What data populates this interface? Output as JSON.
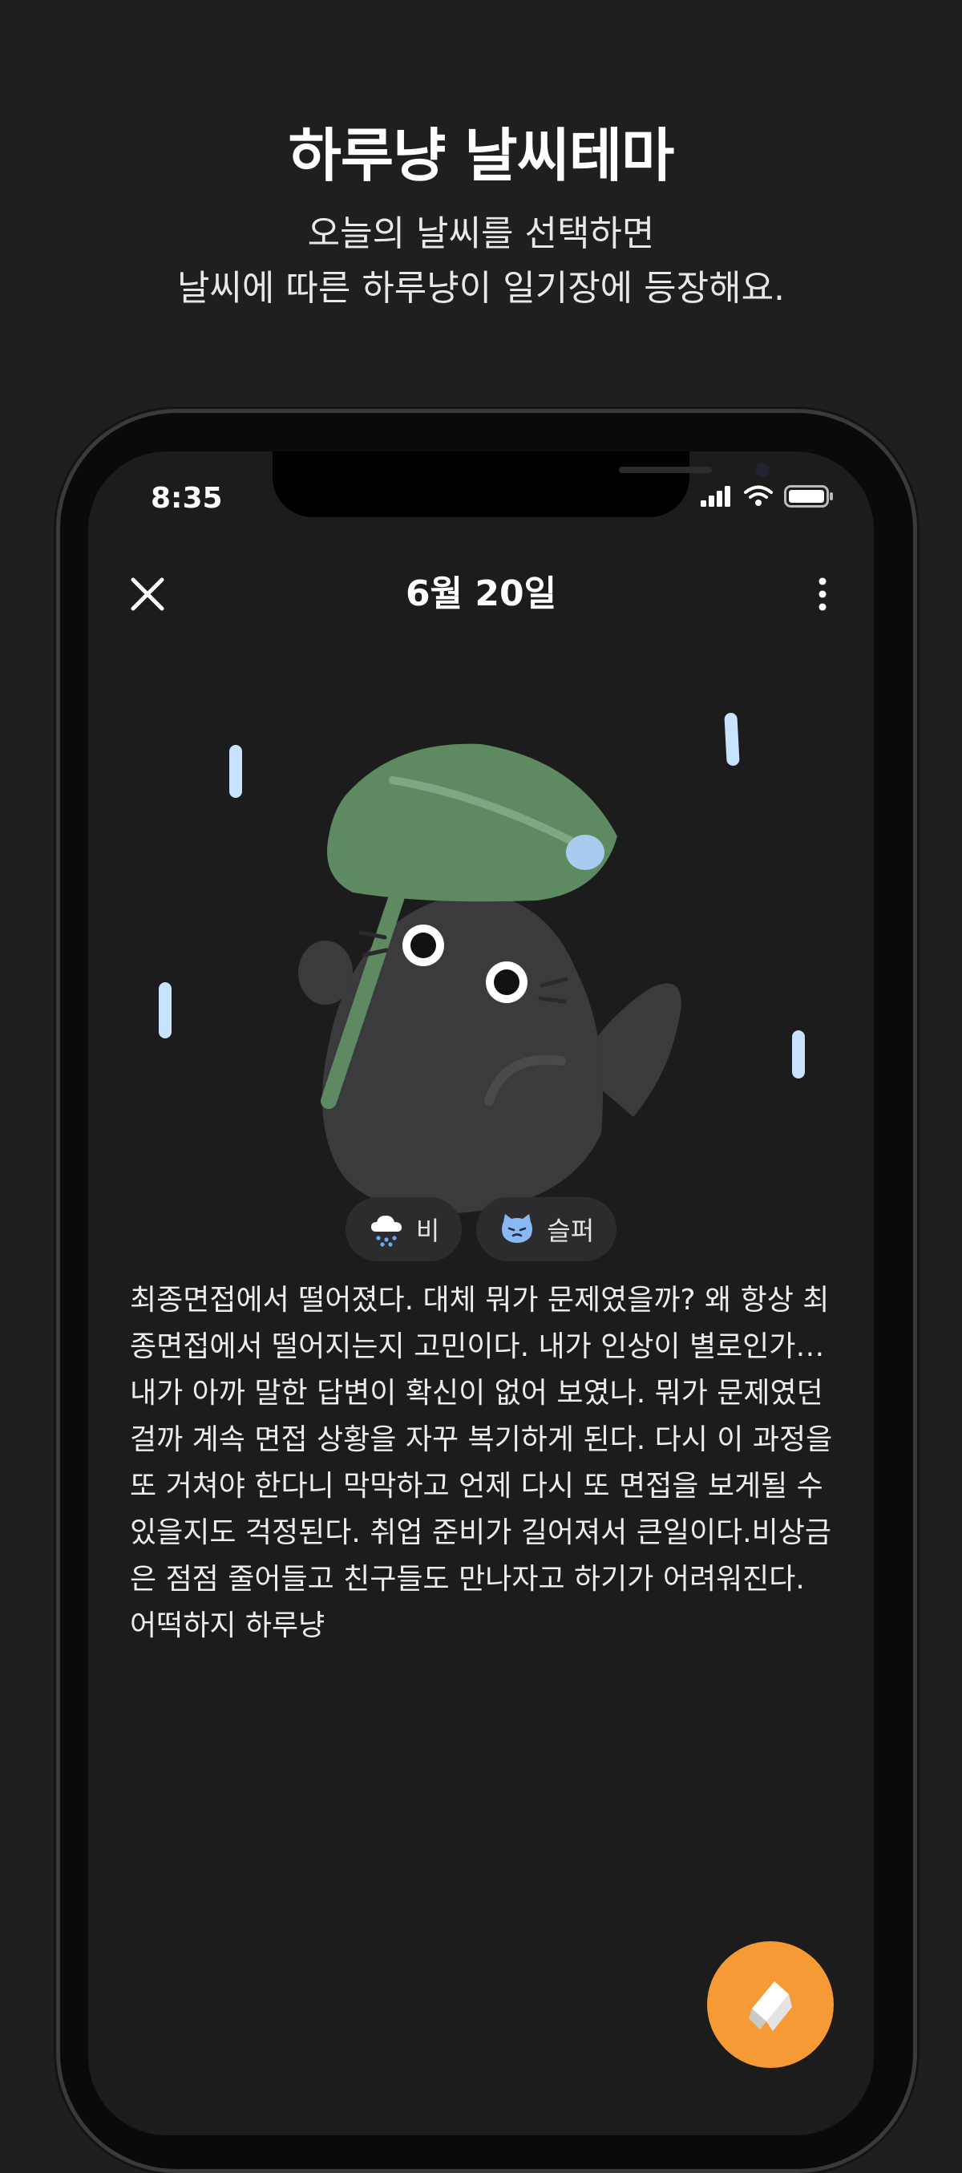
{
  "promo": {
    "title": "하루냥 날씨테마",
    "subtitle_line1": "오늘의 날씨를 선택하면",
    "subtitle_line2": "날씨에 따른 하루냥이 일기장에 등장해요."
  },
  "status_bar": {
    "time": "8:35"
  },
  "nav": {
    "close_icon": "close-icon",
    "title": "6월 20일",
    "more_icon": "more-vertical-icon"
  },
  "chips": {
    "weather": {
      "icon": "rain-cloud-icon",
      "label": "비"
    },
    "mood": {
      "icon": "sad-cat-icon",
      "label": "슬퍼"
    }
  },
  "diary": {
    "text": "최종면접에서 떨어졌다. 대체 뭐가 문제였을까? 왜 항상 최종면접에서 떨어지는지 고민이다. 내가 인상이 별로인가… 내가 아까 말한 답변이 확신이 없어 보였나. 뭐가 문제였던걸까 계속 면접 상황을 자꾸 복기하게 된다. 다시 이 과정을 또 거쳐야 한다니 막막하고 언제 다시 또 면접을 보게될 수 있을지도 걱정된다. 취업 준비가 길어져서 큰일이다.비상금은 점점 줄어들고 친구들도 만나자고 하기가 어려워진다. 어떡하지 하루냥"
  },
  "fab": {
    "icon": "edit-pencil-icon"
  },
  "colors": {
    "background": "#1f1f1f",
    "screen": "#1c1c1d",
    "chip": "#2c2c2e",
    "accent_orange": "#f59a34",
    "leaf_green": "#5e8a62",
    "cat_dark": "#3b3b3d",
    "raindrop": "#c7e3ff"
  }
}
